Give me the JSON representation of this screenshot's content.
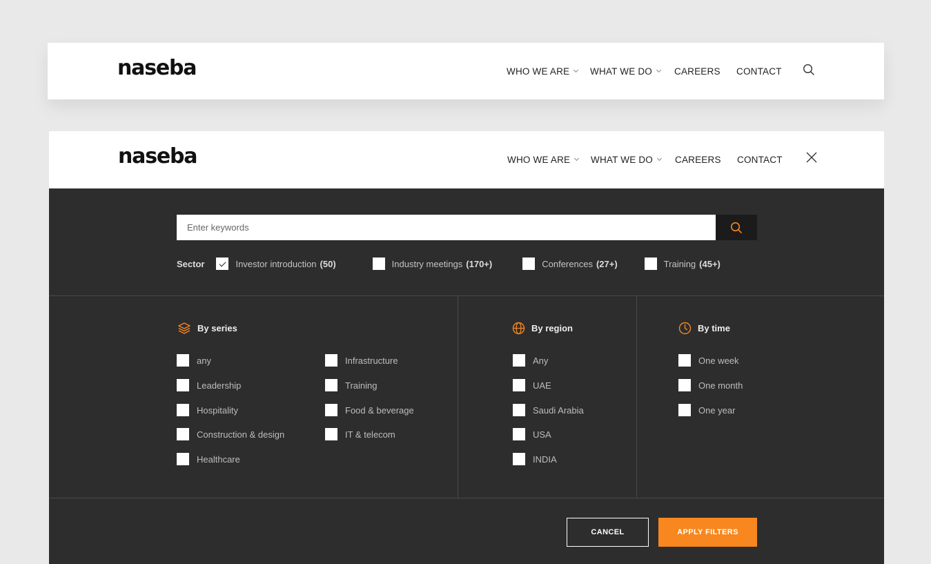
{
  "header_default": {
    "logo": "naseba",
    "nav": [
      "WHO WE ARE",
      "WHAT WE DO",
      "CAREERS",
      "CONTACT"
    ],
    "action_icon": "search-icon"
  },
  "header_open": {
    "logo": "naseba",
    "nav": [
      "WHO WE ARE",
      "WHAT WE DO",
      "CAREERS",
      "CONTACT"
    ],
    "action_icon": "close-icon"
  },
  "search": {
    "placeholder": "Enter keywords",
    "button_icon": "search-icon"
  },
  "sector": {
    "label": "Sector",
    "options": [
      {
        "label": "Investor introduction",
        "count": "(50)",
        "checked": true
      },
      {
        "label": "Industry meetings",
        "count": "(170+)",
        "checked": false
      },
      {
        "label": "Conferences",
        "count": "(27+)",
        "checked": false
      },
      {
        "label": "Training",
        "count": "(45+)",
        "checked": false
      }
    ]
  },
  "by_series": {
    "title": "By series",
    "icon": "layers-icon",
    "col1": [
      "any",
      "Leadership",
      "Hospitality",
      "Construction & design",
      "Healthcare"
    ],
    "col2": [
      "Infrastructure",
      "Training",
      "Food & beverage",
      "IT & telecom"
    ]
  },
  "by_region": {
    "title": "By region",
    "icon": "globe-icon",
    "options": [
      "Any",
      "UAE",
      "Saudi Arabia",
      "USA",
      "INDIA"
    ]
  },
  "by_time": {
    "title": "By time",
    "icon": "clock-icon",
    "options": [
      "One week",
      "One month",
      "One year"
    ]
  },
  "actions": {
    "cancel": "CANCEL",
    "apply": "APPLY FILTERS"
  },
  "colors": {
    "accent": "#f7871e",
    "panel_bg": "#2d2d2d",
    "page_bg": "#e9e9e9"
  }
}
